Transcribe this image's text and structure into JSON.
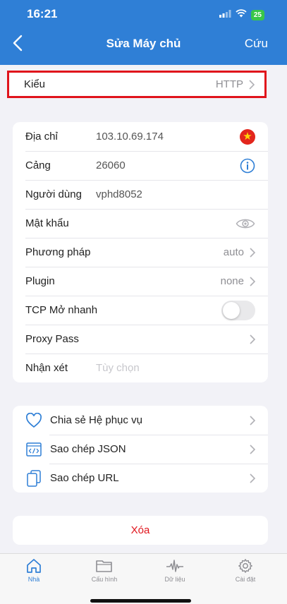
{
  "status": {
    "time": "16:21",
    "battery": "25"
  },
  "nav": {
    "title": "Sửa Máy chủ",
    "save_label": "Cứu"
  },
  "type_row": {
    "label": "Kiểu",
    "value": "HTTP"
  },
  "fields": {
    "address": {
      "label": "Địa chỉ",
      "value": "103.10.69.174"
    },
    "port": {
      "label": "Cảng",
      "value": "26060"
    },
    "user": {
      "label": "Người dùng",
      "value": "vphd8052"
    },
    "password": {
      "label": "Mật khẩu"
    },
    "method": {
      "label": "Phương pháp",
      "value": "auto"
    },
    "plugin": {
      "label": "Plugin",
      "value": "none"
    },
    "tcp_fast_open": {
      "label": "TCP Mở nhanh",
      "enabled": false
    },
    "proxy_pass": {
      "label": "Proxy Pass"
    },
    "note": {
      "label": "Nhận xét",
      "placeholder": "Tùy chọn"
    }
  },
  "actions": {
    "share": "Chia sẻ Hệ phục vụ",
    "copy_json": "Sao chép JSON",
    "copy_url": "Sao chép URL",
    "delete": "Xóa"
  },
  "tabs": {
    "home": "Nhà",
    "config": "Cấu hình",
    "data": "Dữ liệu",
    "settings": "Cài đặt"
  },
  "colors": {
    "accent": "#2f7fd6",
    "danger": "#e0141c"
  }
}
